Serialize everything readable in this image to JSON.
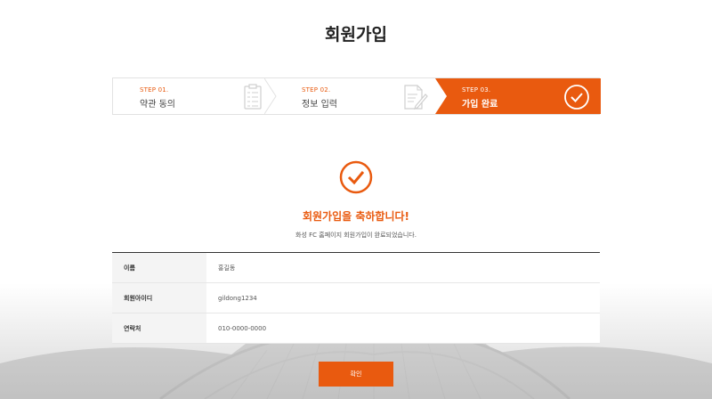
{
  "page": {
    "title": "회원가입"
  },
  "steps": [
    {
      "num": "STEP 01.",
      "label": "약관 동의",
      "active": false
    },
    {
      "num": "STEP 02.",
      "label": "정보 입력",
      "active": false
    },
    {
      "num": "STEP 03.",
      "label": "가입 완료",
      "active": true
    }
  ],
  "result": {
    "title": "회원가입을 축하합니다!",
    "message": "화성 FC 홈페이지 회원가입이 완료되었습니다."
  },
  "info": [
    {
      "label": "이름",
      "value": "홍길동"
    },
    {
      "label": "회원아이디",
      "value": "gildong1234"
    },
    {
      "label": "연락처",
      "value": "010-0000-0000"
    }
  ],
  "actions": {
    "confirm_label": "확인"
  },
  "colors": {
    "accent": "#e95a0f",
    "table_head_bg": "#f4f4f4",
    "title": "#222222"
  }
}
